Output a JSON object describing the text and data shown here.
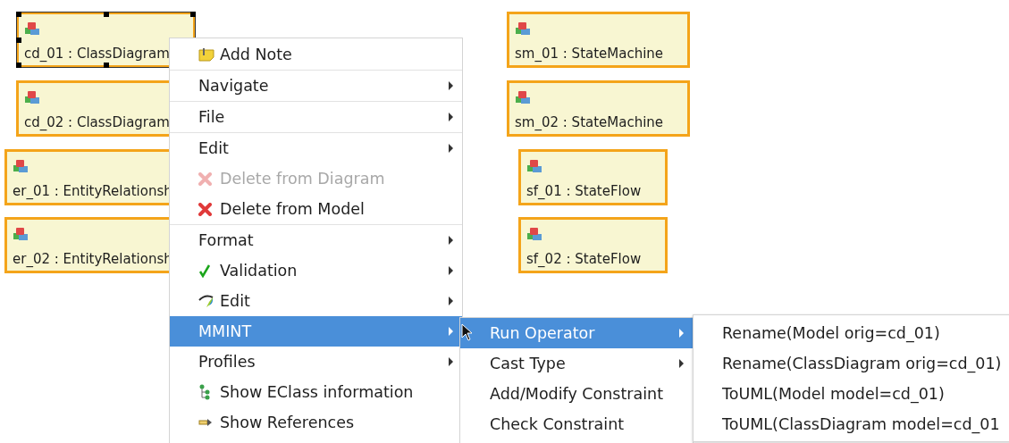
{
  "nodes": [
    {
      "label": "cd_01 : ClassDiagram",
      "selected": true
    },
    {
      "label": "cd_02 : ClassDiagram",
      "selected": false
    },
    {
      "label": "er_01 : EntityRelationsh",
      "selected": false
    },
    {
      "label": "er_02 : EntityRelationsh",
      "selected": false
    },
    {
      "label": "sm_01 : StateMachine",
      "selected": false
    },
    {
      "label": "sm_02 : StateMachine",
      "selected": false
    },
    {
      "label": "sf_01 : StateFlow",
      "selected": false
    },
    {
      "label": "sf_02 : StateFlow",
      "selected": false
    }
  ],
  "context_menu": [
    {
      "kind": "note",
      "label": "Add Note",
      "disabled": false,
      "selected": false
    },
    {
      "kind": "separator"
    },
    {
      "kind": "submenu",
      "label": "Navigate",
      "disabled": false,
      "selected": false
    },
    {
      "kind": "separator"
    },
    {
      "kind": "submenu",
      "label": "File",
      "disabled": false,
      "selected": false
    },
    {
      "kind": "separator"
    },
    {
      "kind": "submenu",
      "label": "Edit",
      "disabled": false,
      "selected": false
    },
    {
      "kind": "delete",
      "label": "Delete from Diagram",
      "disabled": true,
      "selected": false
    },
    {
      "kind": "delete",
      "label": "Delete from Model",
      "disabled": false,
      "selected": false
    },
    {
      "kind": "separator"
    },
    {
      "kind": "submenu",
      "label": "Format",
      "disabled": false,
      "selected": false
    },
    {
      "kind": "check",
      "label": "Validation",
      "disabled": false,
      "selected": false,
      "submenu": true
    },
    {
      "kind": "plugin",
      "label": "Edit",
      "disabled": false,
      "selected": false,
      "submenu": true
    },
    {
      "kind": "submenu",
      "label": "MMINT",
      "disabled": false,
      "selected": true
    },
    {
      "kind": "submenu",
      "label": "Profiles",
      "disabled": false,
      "selected": false
    },
    {
      "kind": "tree",
      "label": "Show EClass information",
      "disabled": false,
      "selected": false
    },
    {
      "kind": "link",
      "label": "Show References",
      "disabled": false,
      "selected": false
    }
  ],
  "mmint_submenu": [
    {
      "label": "Run Operator",
      "submenu": true,
      "selected": true
    },
    {
      "label": "Cast Type",
      "submenu": true,
      "selected": false
    },
    {
      "label": "Add/Modify Constraint",
      "submenu": false,
      "selected": false
    },
    {
      "label": "Check Constraint",
      "submenu": false,
      "selected": false
    }
  ],
  "operators_submenu": [
    {
      "label": "Rename(Model orig=cd_01)"
    },
    {
      "label": "Rename(ClassDiagram orig=cd_01)"
    },
    {
      "label": "ToUML(Model model=cd_01)"
    },
    {
      "label": "ToUML(ClassDiagram model=cd_01"
    }
  ]
}
